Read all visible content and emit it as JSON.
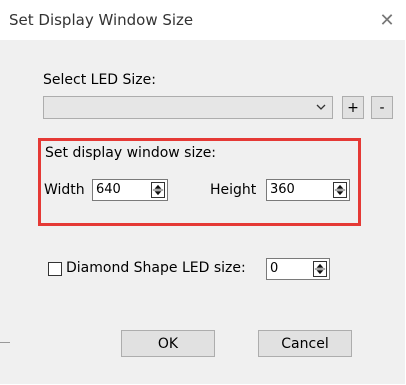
{
  "window": {
    "title": "Set Display Window Size",
    "close_glyph": "✕"
  },
  "led_size": {
    "label": "Select LED Size:",
    "selected_value": "",
    "add_label": "+",
    "remove_label": "-"
  },
  "display_window": {
    "label": "Set display window size:",
    "width_label": "Width",
    "width_value": "640",
    "height_label": "Height",
    "height_value": "360"
  },
  "diamond": {
    "checkbox_label": "Diamond Shape LED size:",
    "checked": false,
    "value": "0"
  },
  "buttons": {
    "ok": "OK",
    "cancel": "Cancel"
  },
  "colors": {
    "highlight": "#e53935",
    "dialog_bg": "#f0f0f0"
  }
}
